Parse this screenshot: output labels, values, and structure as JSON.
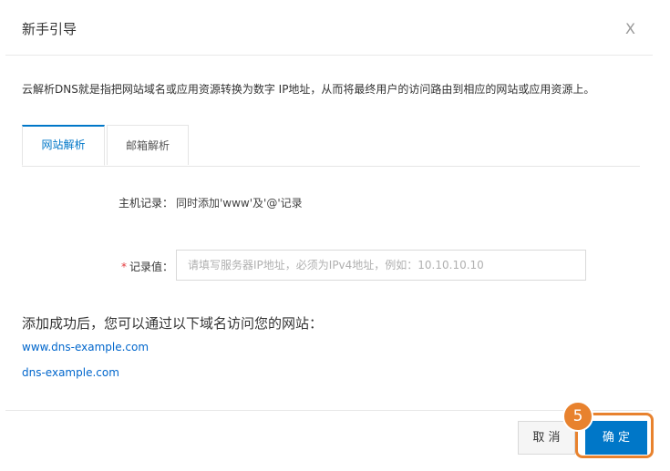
{
  "dialog": {
    "title": "新手引导",
    "close_glyph": "X",
    "intro": "云解析DNS就是指把网站域名或应用资源转换为数字 IP地址，从而将最终用户的访问路由到相应的网站或应用资源上。"
  },
  "tabs": [
    {
      "label": "网站解析",
      "active": true
    },
    {
      "label": "邮箱解析",
      "active": false
    }
  ],
  "form": {
    "host_label": "主机记录：",
    "host_value": "同时添加'www'及'@'记录",
    "required_mark": "*",
    "value_label": "记录值：",
    "value_placeholder": "请填写服务器IP地址，必须为IPv4地址，例如：10.10.10.10",
    "value_current": ""
  },
  "result": {
    "success_text": "添加成功后，您可以通过以下域名访问您的网站：",
    "links": [
      "www.dns-example.com",
      "dns-example.com"
    ]
  },
  "footer": {
    "cancel_label": "取 消",
    "confirm_label": "确 定",
    "step_number": "5"
  },
  "colors": {
    "accent": "#0077c8",
    "highlight": "#e8822e",
    "required": "#e4393c",
    "link": "#0066cc"
  }
}
